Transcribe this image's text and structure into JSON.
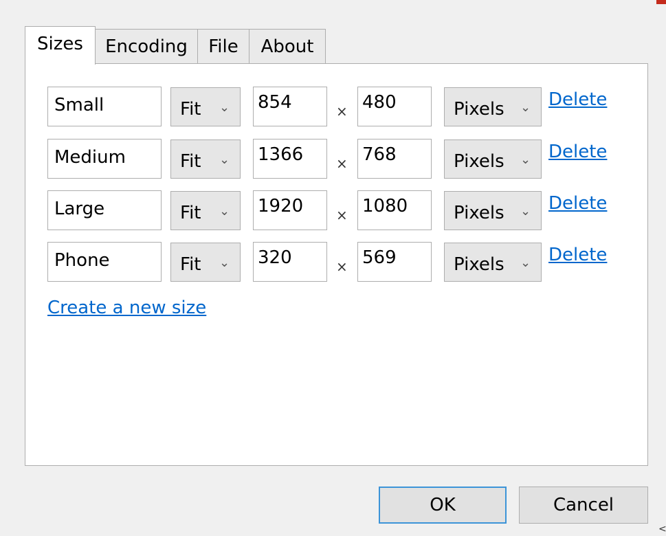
{
  "tabs": [
    {
      "label": "Sizes",
      "active": true
    },
    {
      "label": "Encoding",
      "active": false
    },
    {
      "label": "File",
      "active": false
    },
    {
      "label": "About",
      "active": false
    }
  ],
  "sizes": [
    {
      "name": "Small",
      "mode": "Fit",
      "width": "854",
      "height": "480",
      "unit": "Pixels",
      "delete_label": "Delete"
    },
    {
      "name": "Medium",
      "mode": "Fit",
      "width": "1366",
      "height": "768",
      "unit": "Pixels",
      "delete_label": "Delete"
    },
    {
      "name": "Large",
      "mode": "Fit",
      "width": "1920",
      "height": "1080",
      "unit": "Pixels",
      "delete_label": "Delete"
    },
    {
      "name": "Phone",
      "mode": "Fit",
      "width": "320",
      "height": "569",
      "unit": "Pixels",
      "delete_label": "Delete"
    }
  ],
  "times_symbol": "×",
  "chevron_glyph": "⌄",
  "create_link": "Create a new size",
  "buttons": {
    "ok": "OK",
    "cancel": "Cancel"
  },
  "corner_glyph": "<",
  "colors": {
    "link": "#0066cc",
    "default_button_border": "#3c94d8",
    "close_button": "#c42b1c"
  },
  "icons": {
    "dropdown": "chevron-down-icon",
    "close": "close-icon"
  }
}
